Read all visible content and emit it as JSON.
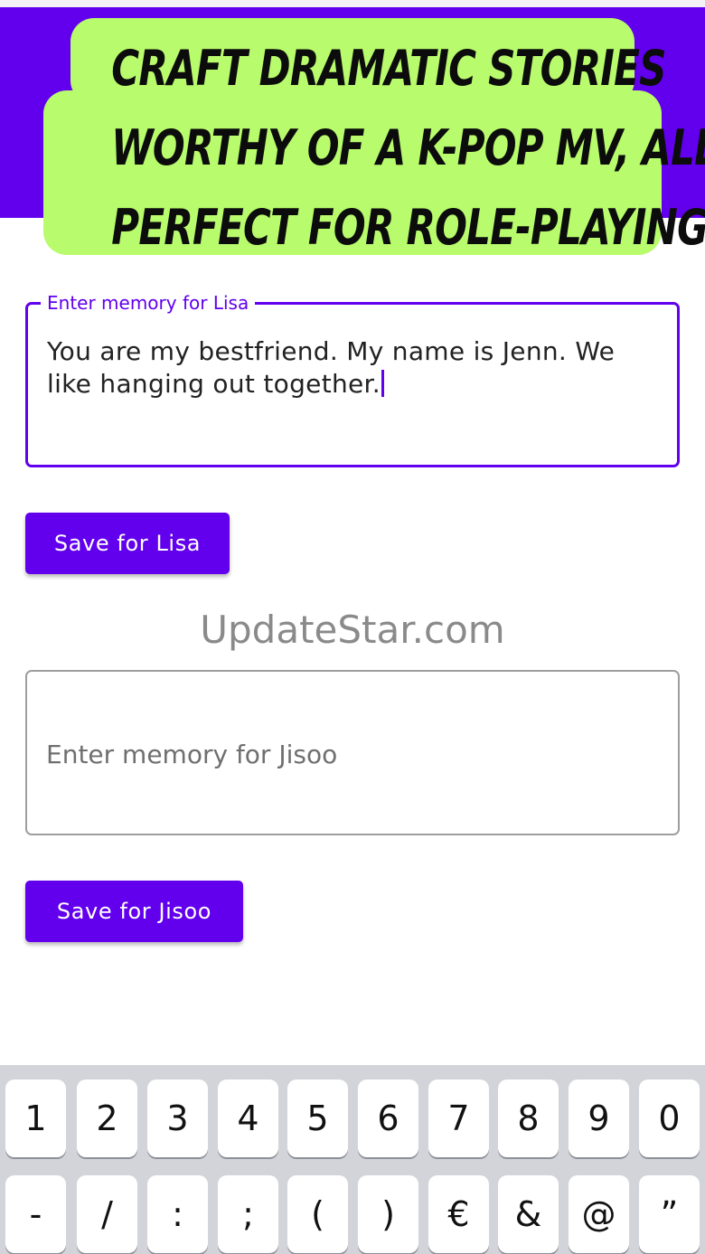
{
  "banner": {
    "line1": "Craft dramatic stories",
    "line2": "worthy of a K-pop MV, all",
    "line3": "perfect for role-playing"
  },
  "memory_lisa": {
    "label": "Enter memory for Lisa",
    "value": "You are my bestfriend. My name is Jenn. We like hanging out together.",
    "button": "Save for Lisa"
  },
  "watermark": "UpdateStar.com",
  "memory_jisoo": {
    "placeholder": "Enter memory for Jisoo",
    "button": "Save for Jisoo"
  },
  "keyboard": {
    "row1": [
      "1",
      "2",
      "3",
      "4",
      "5",
      "6",
      "7",
      "8",
      "9",
      "0"
    ],
    "row2": [
      "-",
      "/",
      ":",
      ";",
      "(",
      ")",
      "€",
      "&",
      "@",
      "”"
    ]
  },
  "colors": {
    "accent": "#6200ee",
    "banner": "#b8fb6c"
  }
}
